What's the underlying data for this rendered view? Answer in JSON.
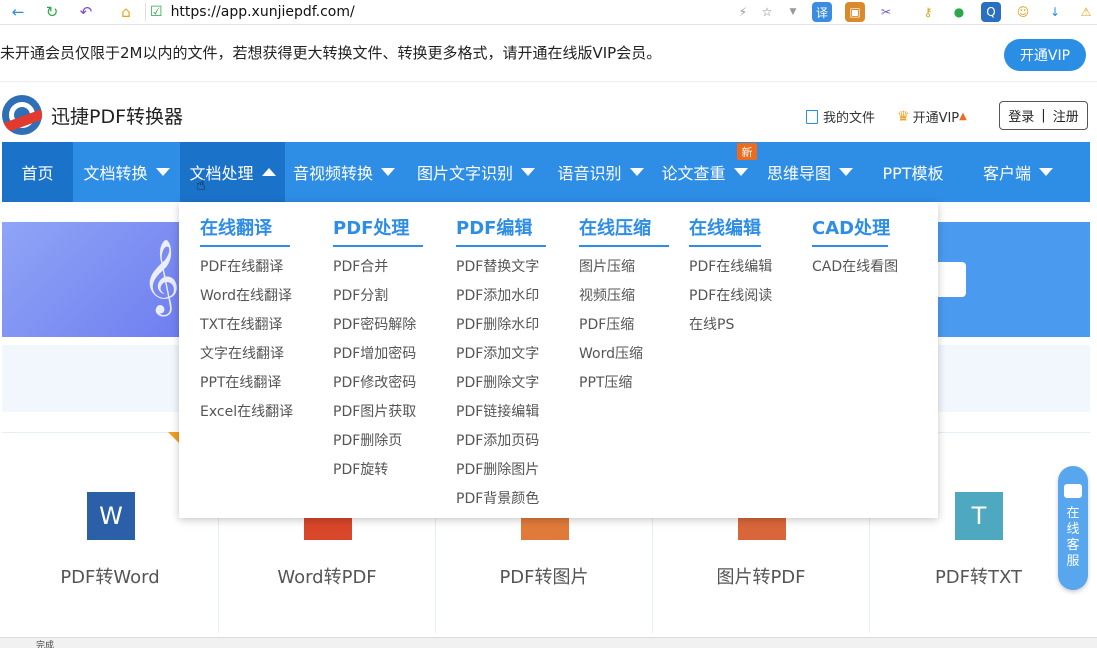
{
  "browser": {
    "url": "https://app.xunjiepdf.com/"
  },
  "notice": {
    "text": "未开通会员仅限于2M以内的文件，若想获得更大转换文件、转换更多格式，请开通在线版VIP会员。",
    "button": "开通VIP"
  },
  "header": {
    "site_name": "迅捷PDF转换器",
    "my_files": "我的文件",
    "vip": "开通VIP",
    "login": "登录",
    "separator": "|",
    "register": "注册"
  },
  "nav": {
    "items": [
      {
        "label": "首页",
        "dropdown": false
      },
      {
        "label": "文档转换",
        "dropdown": true
      },
      {
        "label": "文档处理",
        "dropdown": true,
        "open": true
      },
      {
        "label": "音视频转换",
        "dropdown": true
      },
      {
        "label": "图片文字识别",
        "dropdown": true
      },
      {
        "label": "语音识别",
        "dropdown": true
      },
      {
        "label": "论文查重",
        "dropdown": true
      },
      {
        "label": "思维导图",
        "dropdown": true
      },
      {
        "label": "PPT模板",
        "dropdown": false
      },
      {
        "label": "客户端",
        "dropdown": true
      }
    ],
    "new_badge": "新"
  },
  "dropdown": {
    "columns": [
      {
        "heading": "在线翻译",
        "items": [
          "PDF在线翻译",
          "Word在线翻译",
          "TXT在线翻译",
          "文字在线翻译",
          "PPT在线翻译",
          "Excel在线翻译"
        ]
      },
      {
        "heading": "PDF处理",
        "items": [
          "PDF合并",
          "PDF分割",
          "PDF密码解除",
          "PDF增加密码",
          "PDF修改密码",
          "PDF图片获取",
          "PDF删除页",
          "PDF旋转"
        ]
      },
      {
        "heading": "PDF编辑",
        "items": [
          "PDF替换文字",
          "PDF添加水印",
          "PDF删除水印",
          "PDF添加文字",
          "PDF删除文字",
          "PDF链接编辑",
          "PDF添加页码",
          "PDF删除图片",
          "PDF背景颜色"
        ]
      },
      {
        "heading": "在线压缩",
        "items": [
          "图片压缩",
          "视频压缩",
          "PDF压缩",
          "Word压缩",
          "PPT压缩"
        ]
      },
      {
        "heading": "在线编辑",
        "items": [
          "PDF在线编辑",
          "PDF在线阅读",
          "在线PS"
        ]
      },
      {
        "heading": "CAD处理",
        "items": [
          "CAD在线看图"
        ]
      }
    ]
  },
  "cards": [
    {
      "label": "PDF转Word",
      "icon": "word-icon",
      "glyph": "W",
      "color": "#2b5fa8"
    },
    {
      "label": "Word转PDF",
      "icon": "pdf-icon",
      "glyph": "",
      "color": "#d9472a"
    },
    {
      "label": "PDF转图片",
      "icon": "image-icon",
      "glyph": "",
      "color": "#e07a3a"
    },
    {
      "label": "图片转PDF",
      "icon": "pdf-image-icon",
      "glyph": "",
      "color": "#d9663a"
    },
    {
      "label": "PDF转TXT",
      "icon": "txt-icon",
      "glyph": "T",
      "color": "#4ea8c0"
    }
  ],
  "side_service": {
    "label": "在线客服"
  },
  "status": {
    "text": "完成"
  },
  "colors": {
    "nav_blue": "#2e8de5",
    "nav_active": "#1b73c9",
    "badge_orange": "#ee6a1d"
  }
}
